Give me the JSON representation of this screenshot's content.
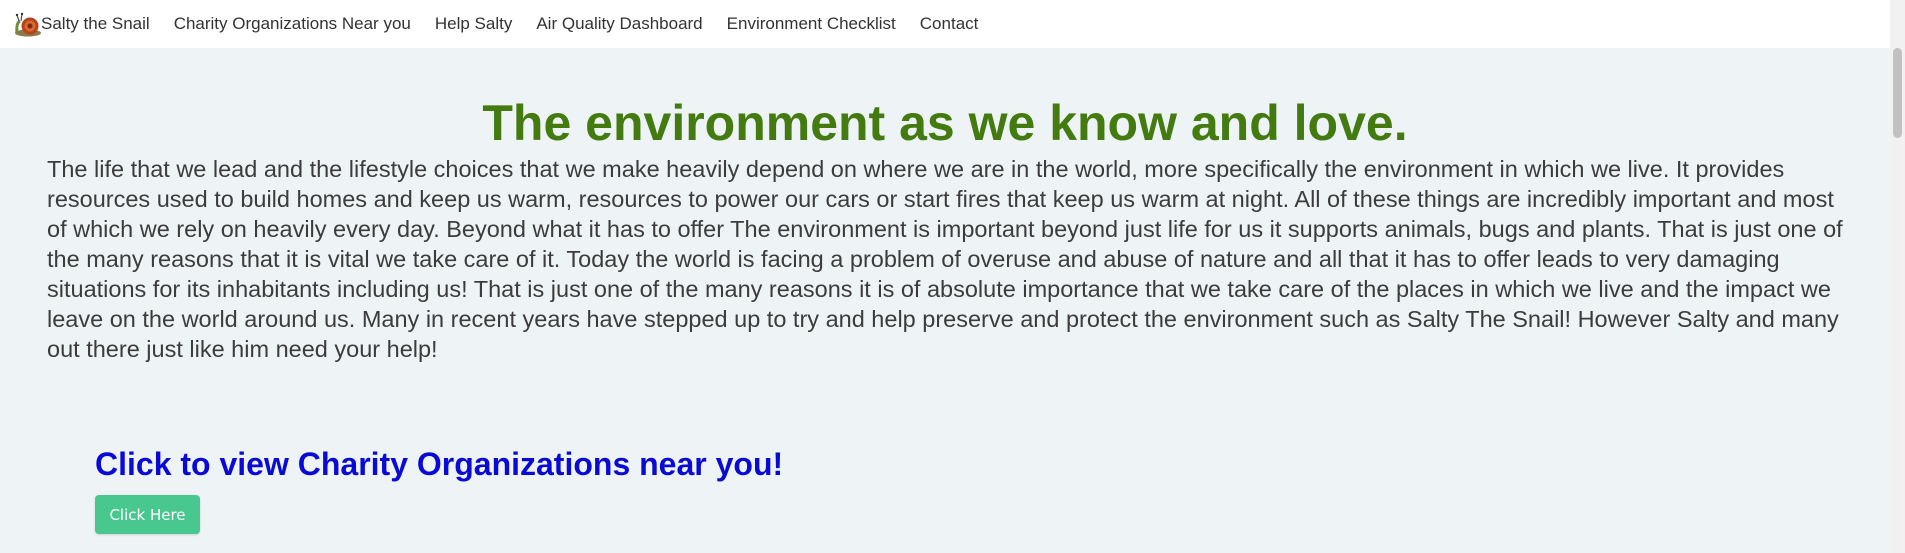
{
  "navbar": {
    "brand": "Salty the Snail",
    "logo_icon": "snail-icon",
    "links": [
      "Charity Organizations Near you",
      "Help Salty",
      "Air Quality Dashboard",
      "Environment Checklist",
      "Contact"
    ]
  },
  "main": {
    "title": "The environment as we know and love.",
    "intro": "The life that we lead and the lifestyle choices that we make heavily depend on where we are in the world, more specifically the environment in which we live. It provides resources used to build homes and keep us warm, resources to power our cars or start fires that keep us warm at night. All of these things are incredibly important and most of which we rely on heavily every day. Beyond what it has to offer The environment is important beyond just life for us it supports animals, bugs and plants. That is just one of the many reasons that it is vital we take care of it. Today the world is facing a problem of overuse and abuse of nature and all that it has to offer leads to very damaging situations for its inhabitants including us! That is just one of the many reasons it is of absolute importance that we take care of the places in which we live and the impact we leave on the world around us. Many in recent years have stepped up to try and help preserve and protect the environment such as Salty The Snail! However Salty and many out there just like him need your help!",
    "cta_heading": "Click to view Charity Organizations near you!",
    "cta_button": "Click Here"
  },
  "colors": {
    "title": "#437b10",
    "cta_heading": "#0a0ad6",
    "button": "#48c78e",
    "background": "#eef3f6"
  }
}
